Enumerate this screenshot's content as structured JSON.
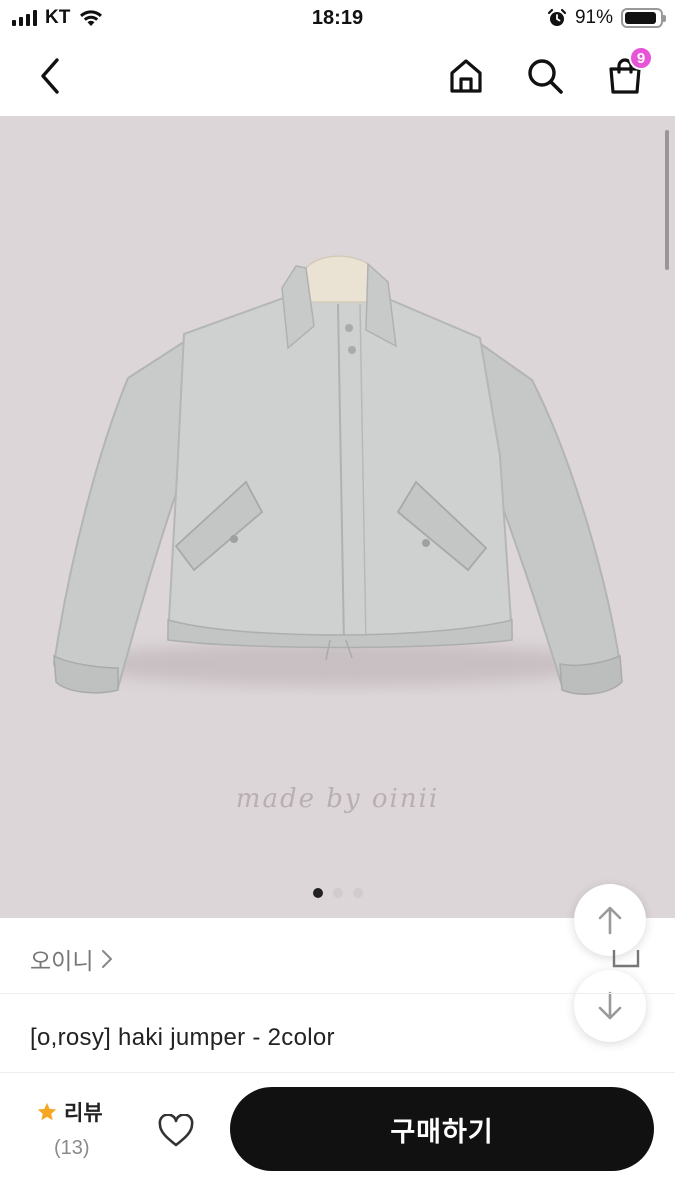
{
  "status_bar": {
    "carrier": "KT",
    "time": "18:19",
    "battery_percent": "91%",
    "battery_level": 0.91
  },
  "header": {
    "back_icon": "chevron-left-icon",
    "home_icon": "home-icon",
    "search_icon": "search-icon",
    "cart_icon": "shopping-bag-icon",
    "cart_badge": "9",
    "badge_color": "#e754d8"
  },
  "gallery": {
    "watermark": "made by oinii",
    "background_color": "#ddd6d8",
    "total_images": 3,
    "active_index": 0
  },
  "shop": {
    "name": "오이니",
    "chevron": "›"
  },
  "product": {
    "title": "[o,rosy] haki jumper - 2color"
  },
  "bottom_bar": {
    "review_label": "리뷰",
    "review_count": "(13)",
    "star_color": "#f5a623",
    "buy_label": "구매하기"
  }
}
